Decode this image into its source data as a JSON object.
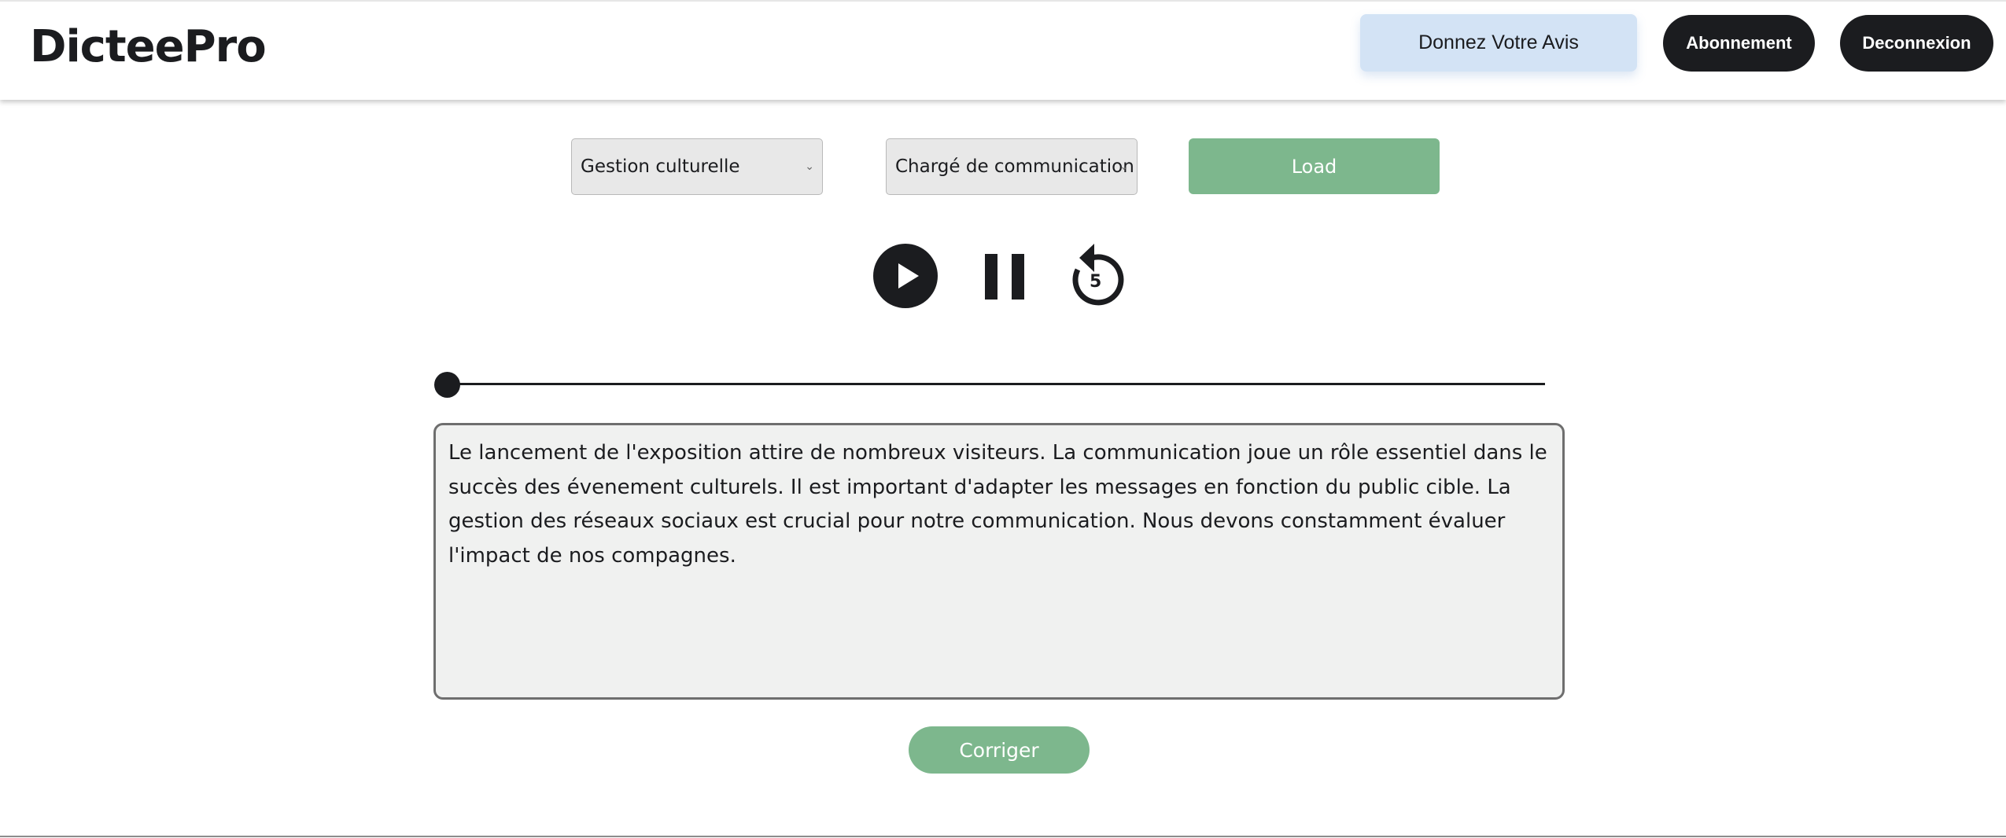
{
  "header": {
    "logo": "DicteePro",
    "feedback_label": "Donnez Votre Avis",
    "subscribe_label": "Abonnement",
    "logout_label": "Deconnexion"
  },
  "controls": {
    "domain_select": "Gestion culturelle",
    "role_select": "Chargé de communication",
    "load_label": "Load"
  },
  "player": {
    "play_icon": "play-circle-icon",
    "pause_icon": "pause-icon",
    "replay_icon": "replay-5-icon",
    "replay_seconds": "5",
    "progress": 0
  },
  "dictation": {
    "text": "Le lancement de l'exposition attire de nombreux visiteurs. La communication joue un rôle essentiel dans le succès des évenement culturels. Il est important d'adapter les messages en fonction du public cible. La gestion des réseaux sociaux est crucial pour notre communication. Nous devons constamment évaluer l'impact de nos compagnes."
  },
  "actions": {
    "correct_label": "Corriger"
  },
  "colors": {
    "accent_green": "#7db78d",
    "dark": "#1b1c1f",
    "feedback_bg": "#d3e3f5"
  }
}
